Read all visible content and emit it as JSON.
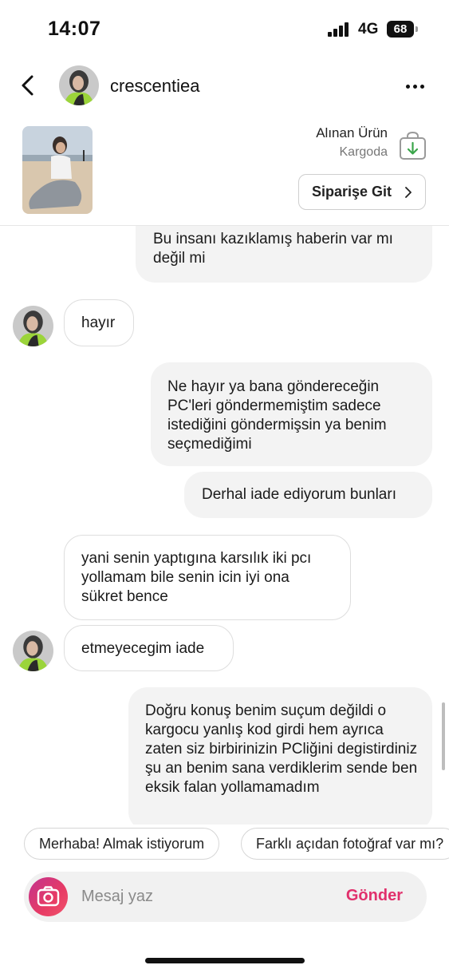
{
  "status_bar": {
    "time": "14:07",
    "network": "4G",
    "battery": "68"
  },
  "header": {
    "username": "crescentiea"
  },
  "product": {
    "title": "Alınan Ürün",
    "status": "Kargoda",
    "order_button": "Siparişe Git"
  },
  "messages": [
    {
      "direction": "out",
      "text": "Bu insanı kazıklamış haberin var mı değil mi"
    },
    {
      "direction": "in",
      "text": "hayır"
    },
    {
      "direction": "out",
      "text": "Ne hayır ya bana göndereceğin PC'leri göndermemiştim sadece istediğini göndermişsin ya benim seçmediğimi"
    },
    {
      "direction": "out",
      "text": "Derhal iade ediyorum bunları"
    },
    {
      "direction": "in",
      "text": "yani senin yaptıgına karsılık iki pcı yollamam bile senin icin iyi ona sükret bence"
    },
    {
      "direction": "in",
      "text": "etmeyecegim iade"
    },
    {
      "direction": "out",
      "text": "Doğru konuş benim suçum değildi o kargocu yanlış kod girdi hem ayrıca zaten siz birbirinizin PCliğini degistirdiniz şu an benim sana verdiklerim sende ben eksik falan yollamamadım"
    }
  ],
  "quick_replies": [
    "Merhaba! Almak istiyorum",
    "Farklı açıdan fotoğraf var mı?"
  ],
  "composer": {
    "placeholder": "Mesaj yaz",
    "send_label": "Gönder"
  },
  "colors": {
    "accent": "#e1306c",
    "outgoing_bubble": "#f3f3f3",
    "download_green": "#3aa54a"
  },
  "icons": {
    "back": "chevron-left-icon",
    "more": "more-horizontal-icon",
    "bag": "shopping-bag-download-icon",
    "camera": "camera-icon"
  }
}
